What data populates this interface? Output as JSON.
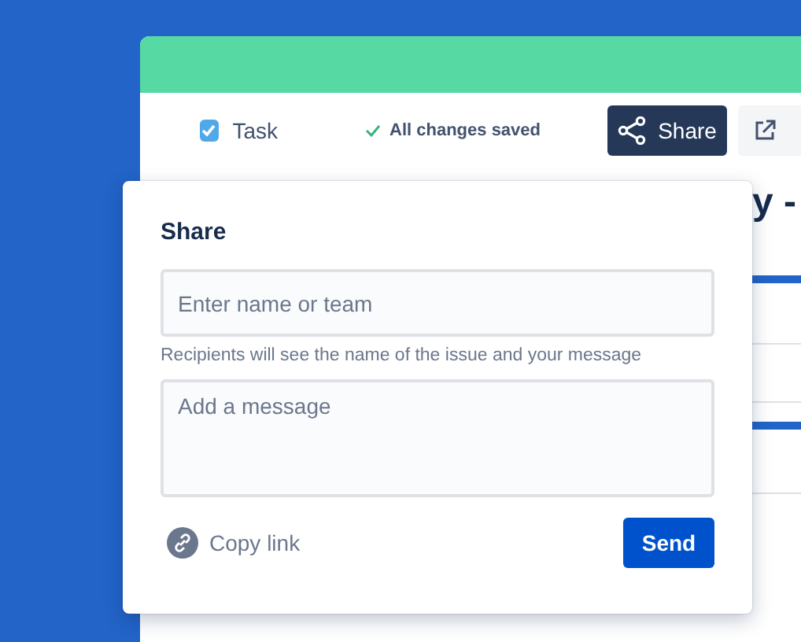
{
  "toolbar": {
    "issue_type": {
      "label": "Task",
      "checked": true
    },
    "save_status": "All changes saved",
    "share_button": "Share"
  },
  "issue_title": "y -",
  "share_popup": {
    "title": "Share",
    "recipients": {
      "placeholder": "Enter name or team"
    },
    "hint": "Recipients will see the name of the issue and your message",
    "message": {
      "placeholder": "Add a message"
    },
    "copy_link": "Copy link",
    "send_button": "Send"
  }
}
